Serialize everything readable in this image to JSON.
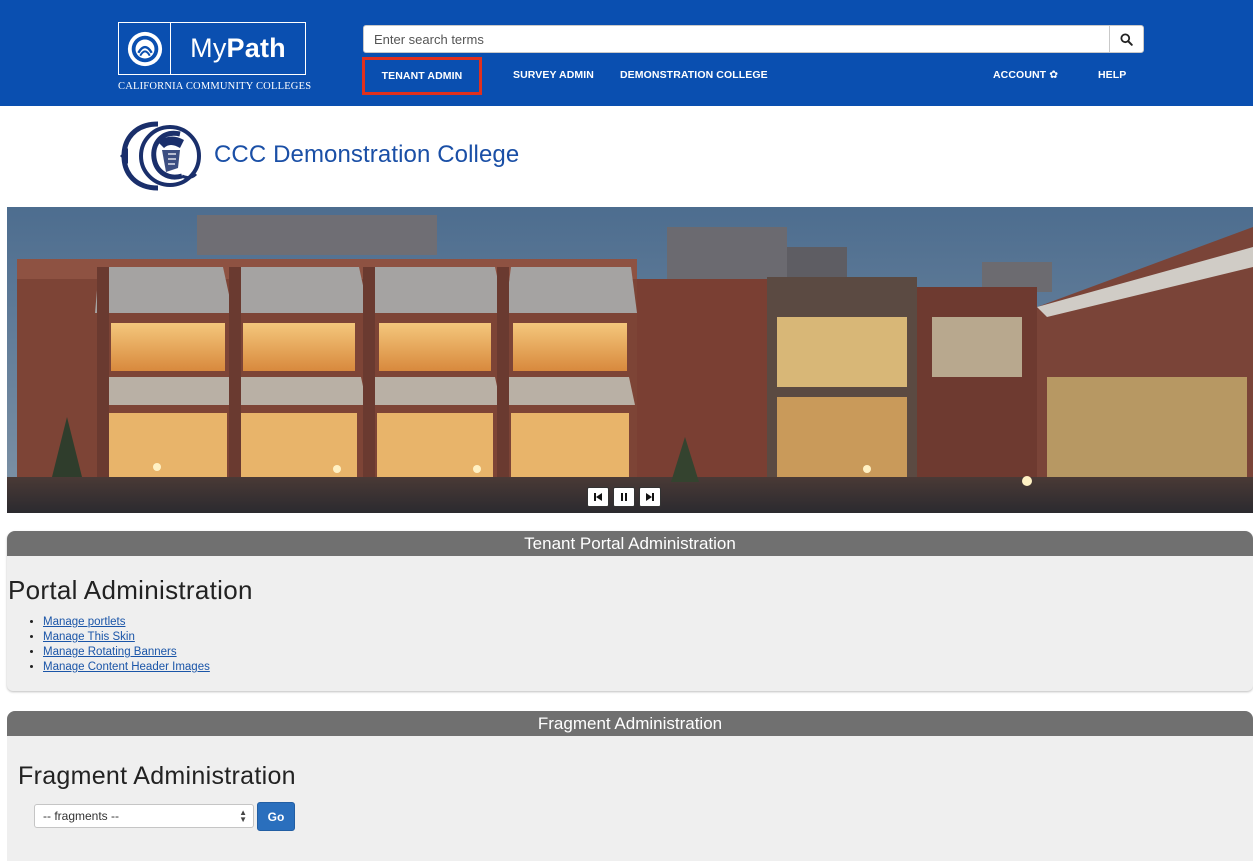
{
  "header": {
    "logo_text_regular": "My",
    "logo_text_bold": "Path",
    "logo_subtitle": "CALIFORNIA COMMUNITY COLLEGES",
    "search_placeholder": "Enter search terms",
    "nav": {
      "tenant_admin": "TENANT ADMIN",
      "survey_admin": "SURVEY ADMIN",
      "demonstration_college": "DEMONSTRATION COLLEGE",
      "account": "ACCOUNT",
      "help": "HELP"
    },
    "highlight_color": "#e0301e",
    "bar_color": "#0a4fb0"
  },
  "college": {
    "name": "CCC Demonstration College"
  },
  "banner": {
    "controls": [
      "previous-icon",
      "pause-icon",
      "next-icon"
    ]
  },
  "panel_tenant": {
    "header": "Tenant Portal Administration",
    "title": "Portal Administration",
    "links": [
      "Manage portlets",
      "Manage This Skin",
      "Manage Rotating Banners",
      "Manage Content Header Images"
    ]
  },
  "panel_fragment": {
    "header": "Fragment Administration",
    "title": "Fragment Administration",
    "select_value": "-- fragments --",
    "go_label": "Go"
  }
}
